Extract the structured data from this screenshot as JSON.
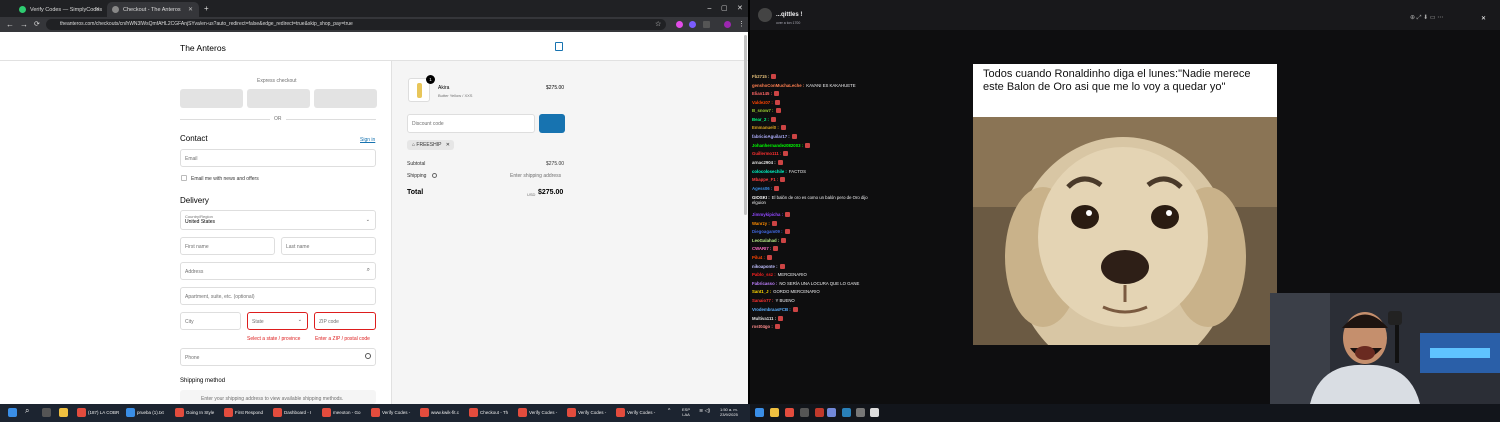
{
  "browser": {
    "tabs": [
      {
        "label": "Verify Codes — SimplyCodes",
        "active": false
      },
      {
        "label": "Checkout - The Anteros",
        "active": true
      }
    ],
    "new_tab": "+",
    "url": "theanteros.com/checkouts/cn/hWN3lWsQmfAHL2CGFAnjSYva/en-us?auto_redirect=false&edge_redirect=true&skip_shop_pay=true"
  },
  "checkout": {
    "store_name": "The Anteros",
    "express_checkout": "Express checkout",
    "or": "OR",
    "contact": {
      "title": "Contact",
      "sign_in": "Sign in",
      "email_placeholder": "Email",
      "news_label": "Email me with news and offers"
    },
    "delivery": {
      "title": "Delivery",
      "country_label": "Country/Region",
      "country_value": "United States",
      "first_name": "First name",
      "last_name": "Last name",
      "address": "Address",
      "apartment": "Apartment, suite, etc. (optional)",
      "city": "City",
      "state": "State",
      "zip": "ZIP code",
      "state_error": "Select a state / province",
      "zip_error": "Enter a ZIP / postal code",
      "phone": "Phone"
    },
    "shipping_method": {
      "title": "Shipping method",
      "hint": "Enter your shipping address to view available shipping methods."
    }
  },
  "summary": {
    "item": {
      "name": "Akira",
      "variant": "Butter Yellow / XXS",
      "qty": "1",
      "price": "$275.00"
    },
    "discount_placeholder": "Discount code",
    "discount_tag": "FREESHIP",
    "subtotal_label": "Subtotal",
    "subtotal_value": "$275.00",
    "shipping_label": "Shipping",
    "shipping_value": "Enter shipping address",
    "total_label": "Total",
    "currency": "USD",
    "total_value": "$275.00"
  },
  "stream": {
    "channel": "...qittles !",
    "sub": "over a ton 1700",
    "chat": [
      {
        "user": "Fb2715 :",
        "msg": "",
        "color": "#e5c07b",
        "emote": true
      },
      {
        "user": "genshoConMuchaLeche :",
        "msg": "KAVANI ES KAKAHUETE",
        "color": "#ff7f50",
        "emote": false
      },
      {
        "user": "Elian145 :",
        "msg": "",
        "color": "#ff6666",
        "emote": true
      },
      {
        "user": "Valdez07 :",
        "msg": "",
        "color": "#ff4500",
        "emote": true
      },
      {
        "user": "B_snow7 :",
        "msg": "",
        "color": "#9acd32",
        "emote": true
      },
      {
        "user": "Bear_2 :",
        "msg": "",
        "color": "#00ff7f",
        "emote": true
      },
      {
        "user": "Emmanuel0 :",
        "msg": "",
        "color": "#daa520",
        "emote": true
      },
      {
        "user": "fabricioAguilar17 :",
        "msg": "",
        "color": "#b0b0ff",
        "emote": true
      },
      {
        "user": "Johanhernandez082003 :",
        "msg": "",
        "color": "#00ff00",
        "emote": true
      },
      {
        "user": "Guillermo111 :",
        "msg": "",
        "color": "#ff3030",
        "emote": true
      },
      {
        "user": "arnac2904 :",
        "msg": "",
        "color": "#e0e0e0",
        "emote": true
      },
      {
        "user": "colocolosechile :",
        "msg": "FACTOS",
        "color": "#00ffcc",
        "emote": false
      },
      {
        "user": "Mbappe_F1 :",
        "msg": "",
        "color": "#ff4040",
        "emote": true
      },
      {
        "user": "Agess06 :",
        "msg": "",
        "color": "#3a8ee6",
        "emote": true
      },
      {
        "user": "GIOSKI :",
        "msg": "El balón de oro es como un balón pero de Oro dijo elguion",
        "color": "#ffffff",
        "emote": false
      },
      {
        "user": "Jimmykipicha :",
        "msg": "",
        "color": "#9147ff",
        "emote": true
      },
      {
        "user": "Wanrzy :",
        "msg": "",
        "color": "#ff8c00",
        "emote": true
      },
      {
        "user": "Diegoagam09 :",
        "msg": "",
        "color": "#4169e1",
        "emote": true
      },
      {
        "user": "LeoGalahad :",
        "msg": "",
        "color": "#b8e986",
        "emote": true
      },
      {
        "user": "CWARI7 :",
        "msg": "",
        "color": "#ff6ec7",
        "emote": true
      },
      {
        "user": "Pilu4 :",
        "msg": "",
        "color": "#ff4500",
        "emote": true
      },
      {
        "user": "nikoaponte :",
        "msg": "",
        "color": "#c0c0ff",
        "emote": true
      },
      {
        "user": "Pablo_ssz :",
        "msg": "MERCENARIO",
        "color": "#ff2020",
        "emote": false
      },
      {
        "user": "Fabricasso :",
        "msg": "NO SERÍA UNA LOCURA QUE LO GANE",
        "color": "#c080ff",
        "emote": false
      },
      {
        "user": "Sant1_J :",
        "msg": "GORDO MERCENARIO",
        "color": "#ffd700",
        "emote": false
      },
      {
        "user": "Sanaio77 :",
        "msg": "Y BUENO",
        "color": "#ff3030",
        "emote": false
      },
      {
        "user": "VrodembraasFCB :",
        "msg": "",
        "color": "#5ab0ff",
        "emote": true
      },
      {
        "user": "Multiva111 :",
        "msg": "",
        "color": "#e0e0e0",
        "emote": true
      },
      {
        "user": "rost04go :",
        "msg": "",
        "color": "#ff8c8c",
        "emote": true
      }
    ],
    "meme_caption": "Todos cuando Ronaldinho diga el lunes:\"Nadie merece este Balon de Oro asi que me lo voy a quedar yo\""
  },
  "taskbar": {
    "items": [
      "(187) LA COBR",
      "prueba (1).txt",
      "Going In Style",
      "First Respond",
      "Dashboard - I",
      "meeoton - Go",
      "Verify Codes -",
      "www.kwik-fit.c",
      "Checkout - Th",
      "Verify Codes -",
      "Verify Codes -",
      "Verify Codes -"
    ],
    "lang": "ESP",
    "lang2": "LAA",
    "time": "1:50 a. m.",
    "date": "23/9/2025"
  }
}
